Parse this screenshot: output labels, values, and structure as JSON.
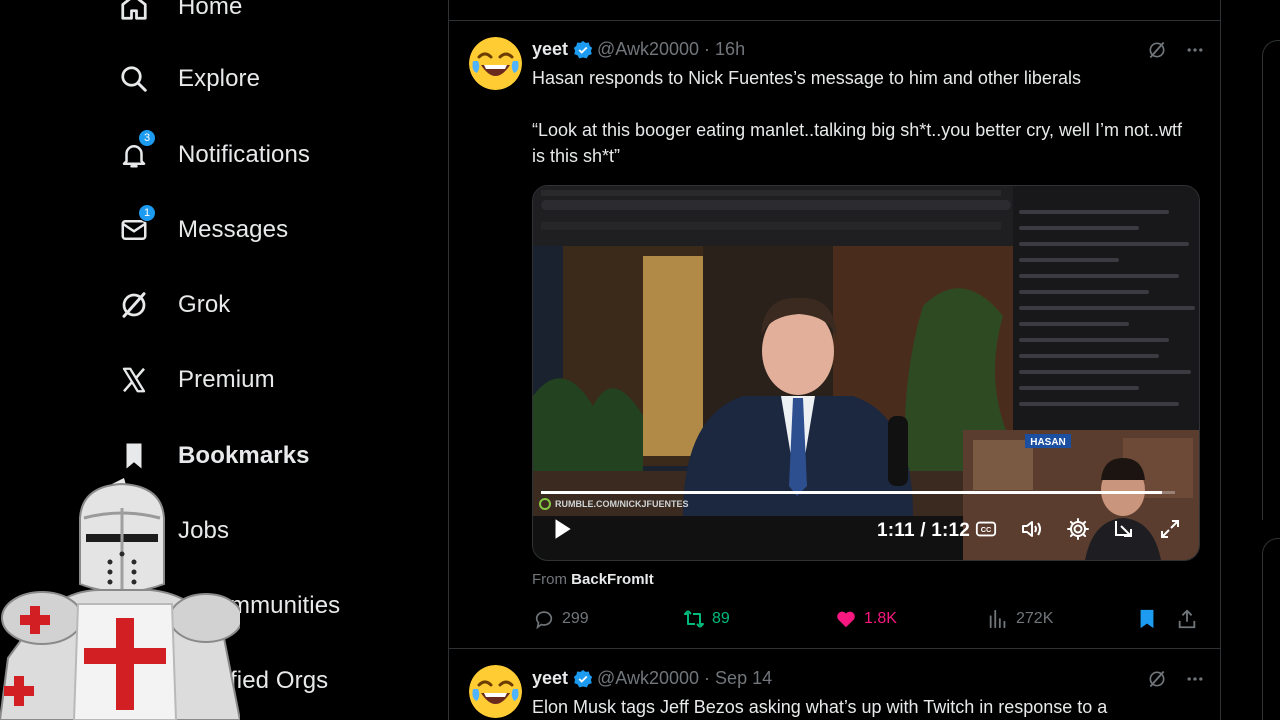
{
  "nav": {
    "items": [
      {
        "label": "Home",
        "icon": "home-icon"
      },
      {
        "label": "Explore",
        "icon": "search-icon"
      },
      {
        "label": "Notifications",
        "icon": "bell-icon",
        "badge": "3"
      },
      {
        "label": "Messages",
        "icon": "mail-icon",
        "badge": "1"
      },
      {
        "label": "Grok",
        "icon": "grok-icon"
      },
      {
        "label": "Premium",
        "icon": "x-logo-icon"
      },
      {
        "label": "Bookmarks",
        "icon": "bookmark-icon"
      },
      {
        "label": "Jobs",
        "icon": "briefcase-icon"
      },
      {
        "label": "mmunities",
        "icon": "communities-icon"
      },
      {
        "label": "fied Orgs",
        "icon": "verified-orgs-icon"
      }
    ]
  },
  "posts": [
    {
      "name": "yeet",
      "handle": "@Awk20000",
      "time": "16h",
      "text_line1": "Hasan responds to Nick Fuentes’s message to him and other liberals",
      "text_line2": "“Look at this booger eating manlet..talking big sh*t..you better cry, well I’m not..wtf is this sh*t”",
      "video": {
        "time": "1:11 / 1:12",
        "progress": 0.98,
        "watermark": "RUMBLE.COM/NICKJFUENTES",
        "cam_label": "HASAN"
      },
      "from_prefix": "From",
      "from_source": "BackFromIt",
      "stats": {
        "replies": "299",
        "reposts": "89",
        "likes": "1.8K",
        "views": "272K"
      }
    },
    {
      "name": "yeet",
      "handle": "@Awk20000",
      "time": "Sep 14",
      "text_line1": "Elon Musk tags Jeff Bezos asking what’s up with Twitch in response to a"
    }
  ],
  "colors": {
    "accent": "#1d9bf0",
    "like": "#f91880",
    "repost": "#00ba7c",
    "muted": "#71767b"
  }
}
